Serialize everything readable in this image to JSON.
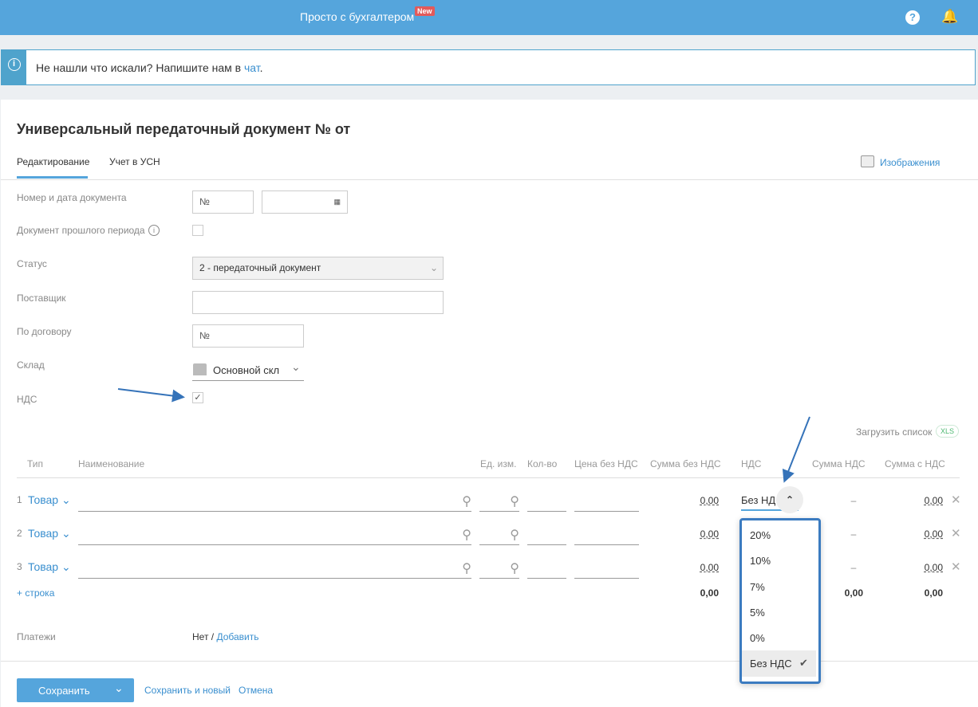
{
  "header": {
    "brand": "Просто с бухгалтером",
    "badge": "New",
    "help_icon": "?",
    "bell_icon": "bell"
  },
  "notice": {
    "text": "Не нашли что искали? Напишите нам в ",
    "link": "чат",
    "end": "."
  },
  "doc": {
    "title": "Универсальный передаточный документ № от"
  },
  "tabs": [
    {
      "label": "Редактирование",
      "active": true
    },
    {
      "label": "Учет в УСН"
    }
  ],
  "images_link": "Изображения",
  "form": {
    "number_label": "Номер и дата документа",
    "number_value": "№",
    "prev_label": "Документ прошлого периода",
    "status_label": "Статус",
    "status_value": "2 - передаточный документ",
    "supplier_label": "Поставщик",
    "contract_label": "По договору",
    "contract_value": "№",
    "warehouse_label": "Склад",
    "warehouse_value": "Основной скл",
    "nds_label": "НДС",
    "nds_checked": true
  },
  "upload": {
    "label": "Загрузить список",
    "badge": "XLS"
  },
  "table": {
    "headers": [
      "Тип",
      "Наименование",
      "Ед. изм.",
      "Кол-во",
      "Цена без НДС",
      "Сумма без НДС",
      "НДС",
      "Сумма НДС",
      "Сумма с НДС"
    ],
    "rows": [
      {
        "n": "1",
        "type": "Товар",
        "sum": "0,00",
        "nds": "Без НДС",
        "nds_sum": "–",
        "total": "0,00"
      },
      {
        "n": "2",
        "type": "Товар",
        "sum": "0,00",
        "nds_sum": "–",
        "total": "0,00"
      },
      {
        "n": "3",
        "type": "Товар",
        "sum": "0,00",
        "nds_sum": "–",
        "total": "0,00"
      }
    ],
    "add_row": "+ строка",
    "totals": {
      "sum": "0,00",
      "nds_sum": "0,00",
      "total": "0,00"
    }
  },
  "nds_dropdown": {
    "options": [
      "20%",
      "10%",
      "7%",
      "5%",
      "0%",
      "Без НДС"
    ],
    "selected": "Без НДС"
  },
  "payments": {
    "label": "Платежи",
    "value": "Нет / ",
    "link": "Добавить"
  },
  "footer": {
    "save": "Сохранить",
    "save_new": "Сохранить и новый",
    "cancel": "Отмена"
  }
}
